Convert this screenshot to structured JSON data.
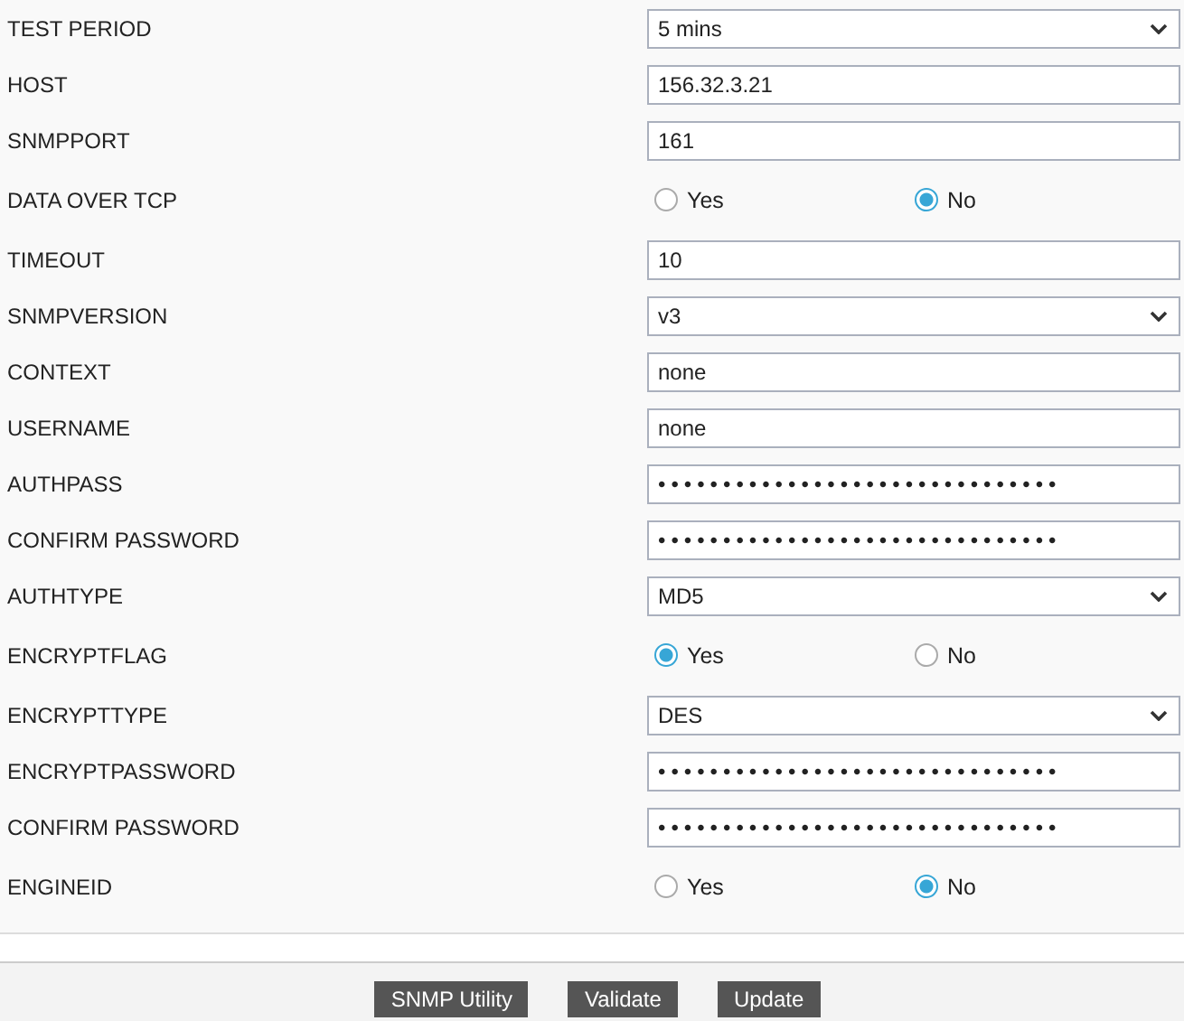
{
  "fields": [
    {
      "label": "TEST PERIOD",
      "kind": "select",
      "value": "5 mins"
    },
    {
      "label": "HOST",
      "kind": "text",
      "value": "156.32.3.21"
    },
    {
      "label": "SNMPPORT",
      "kind": "text",
      "value": "161"
    },
    {
      "label": "DATA OVER TCP",
      "kind": "radio",
      "options": [
        {
          "label": "Yes",
          "selected": false
        },
        {
          "label": "No",
          "selected": true
        }
      ]
    },
    {
      "label": "TIMEOUT",
      "kind": "text",
      "value": "10"
    },
    {
      "label": "SNMPVERSION",
      "kind": "select",
      "value": "v3"
    },
    {
      "label": "CONTEXT",
      "kind": "text",
      "value": "none"
    },
    {
      "label": "USERNAME",
      "kind": "text",
      "value": "none"
    },
    {
      "label": "AUTHPASS",
      "kind": "password",
      "value": "•••••••••••••••••••••••••••••••"
    },
    {
      "label": "CONFIRM PASSWORD",
      "kind": "password",
      "value": "•••••••••••••••••••••••••••••••"
    },
    {
      "label": "AUTHTYPE",
      "kind": "select",
      "value": "MD5"
    },
    {
      "label": "ENCRYPTFLAG",
      "kind": "radio",
      "options": [
        {
          "label": "Yes",
          "selected": true
        },
        {
          "label": "No",
          "selected": false
        }
      ]
    },
    {
      "label": "ENCRYPTTYPE",
      "kind": "select",
      "value": "DES"
    },
    {
      "label": "ENCRYPTPASSWORD",
      "kind": "password",
      "value": "•••••••••••••••••••••••••••••••"
    },
    {
      "label": "CONFIRM PASSWORD",
      "kind": "password",
      "value": "•••••••••••••••••••••••••••••••"
    },
    {
      "label": "ENGINEID",
      "kind": "radio",
      "options": [
        {
          "label": "Yes",
          "selected": false
        },
        {
          "label": "No",
          "selected": true
        }
      ]
    }
  ],
  "buttons": [
    "SNMP Utility",
    "Validate",
    "Update"
  ]
}
